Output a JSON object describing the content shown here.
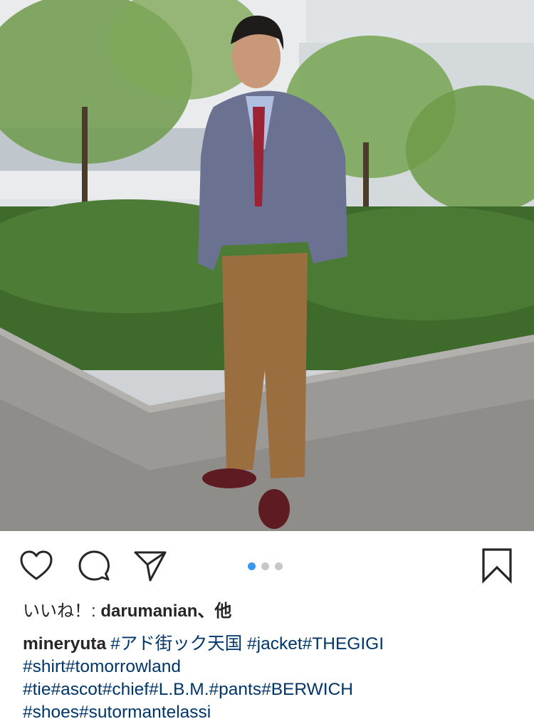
{
  "post": {
    "photo": {
      "description_icon": "photo-image"
    },
    "carousel": {
      "count": 3,
      "active_index": 0,
      "active_color": "#3897f0",
      "inactive_color": "#c7c7c7"
    },
    "actions": {
      "like_icon": "heart-icon",
      "comment_icon": "comment-icon",
      "share_icon": "paper-plane-icon",
      "save_icon": "bookmark-icon"
    },
    "likes": {
      "prefix": "いいね！: ",
      "users": "darumanian、他"
    },
    "caption": {
      "username": "mineryuta",
      "lines": [
        [
          "#アド街ック天国",
          " ",
          "#jacket",
          "#THEGIGI"
        ],
        [
          "#shirt",
          "#tomorrowland"
        ],
        [
          "#tie",
          "#ascot",
          "#chief",
          "#L.B.M.",
          "#pants",
          "#BERWICH"
        ],
        [
          "#shoes",
          "#sutormantelassi"
        ]
      ]
    }
  }
}
